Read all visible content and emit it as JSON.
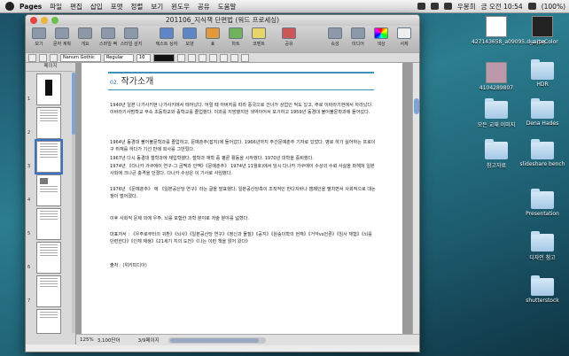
{
  "menubar": {
    "app": "Pages",
    "items": [
      "파일",
      "편집",
      "삽입",
      "포맷",
      "정렬",
      "보기",
      "윈도우",
      "공유",
      "도움말"
    ],
    "user": "우봉희",
    "clock": "금 오전 10:54",
    "battery": "(100%)"
  },
  "window": {
    "title": "201106_지식책 단편법 (워드 프로세싱)"
  },
  "toolbar": {
    "left_items": [
      "보기",
      "문자 계획",
      "개요",
      "스마일 팩",
      "스타일 감지",
      "텍스트 상자",
      "모양",
      "표",
      "차트",
      "코멘트"
    ],
    "right_items": [
      "속성",
      "미디어",
      "색상",
      "서체"
    ],
    "share_label": "공유"
  },
  "formatbar": {
    "font": "Nanum Gothic",
    "style": "Regular",
    "size": "10"
  },
  "sidebar": {
    "header": "페이지",
    "pages": [
      "1",
      "2",
      "3",
      "4",
      "5",
      "6",
      "7",
      "8",
      "9"
    ]
  },
  "document": {
    "heading_num": "02.",
    "heading": "작가소개",
    "paragraphs": [
      "1940년 일본 나가사키현 나가사키에서 태어났다. 어릴 때 아버지를 따라 중국으로 건너가 상업인 적도 있고, 주로 이바라기현에서 자라났다. 이바라기사범학교 부속 초등학교와 중학교를 졸업했다. 이과를 지망했지만 색약이어서 포기하고 1959년 동경대 불어불문학과에 들어갔다.",
      "1964년 동경대 불어불문학과를 졸업하고, 문예춘추(잡지)에 들어갔다. 1966년까지 주간문예춘추 기자로 있었다. 병로 하기 싫어하는 프로이구 취재를 하다가 기선 만에 회사를 그만뒀다.",
      "1967년 다시 동경대 철학과에 재입학했다. 철학과 재학 중 평론 활동을 시작했다. 1970년 대학을 중퇴했다.",
      "1974년 《다나카 가쿠에이 연구-그 금맥과 인맥》《문예춘추》 1974년 11월호)에서 당시 다나카 가쿠에이 수상의 수뢰 사실을 파헤쳐 일본 사회에 크나큰 충격을 던졌다. 다나카 수상은 이 기사로 사임했다.",
      "1976년 《문예춘추》 에 《일본공산당 연구》라는 글을 발표했다. 일본공산당측이 조직적인 반다치바나 캠페인을 펼치면서 사회적으로 대논쟁이 벌어졌다.",
      "이후 사회적 문제 외에 우주, 뇌를 포함한 과학 분야로 저술 분야를 넓혔다.",
      "대표저서 : 《우주로부터의 귀환》《뇌사》《일본공산당 연구》《정신과 물질》《공지》《원숭이학의 현재》《거악vs언론》《임사 체험》《뇌를 단련한다》《인체 재생》《21세기 지의 도전》《나는 이런 책을 읽어 왔다》",
      "출처 : (위키피디아)"
    ]
  },
  "statusbar": {
    "zoom": "125%",
    "word_count": "3,100단어",
    "page_info": "3/9페이지"
  },
  "desktop": {
    "items": [
      {
        "label": "427143658_a09095..._z.jpg",
        "kind": "image"
      },
      {
        "label": "duarteColor",
        "kind": "image"
      },
      {
        "label": "4104289807",
        "kind": "image"
      },
      {
        "label": "HDR",
        "kind": "folder"
      },
      {
        "label": "모든 교재 이미지",
        "kind": "folder"
      },
      {
        "label": "Dena Hades",
        "kind": "folder"
      },
      {
        "label": "참고자료",
        "kind": "folder"
      },
      {
        "label": "slideshare bench",
        "kind": "folder"
      },
      {
        "label": "Presentation",
        "kind": "folder"
      },
      {
        "label": "디자인 참고",
        "kind": "folder"
      },
      {
        "label": "shutterstock",
        "kind": "folder"
      }
    ]
  }
}
